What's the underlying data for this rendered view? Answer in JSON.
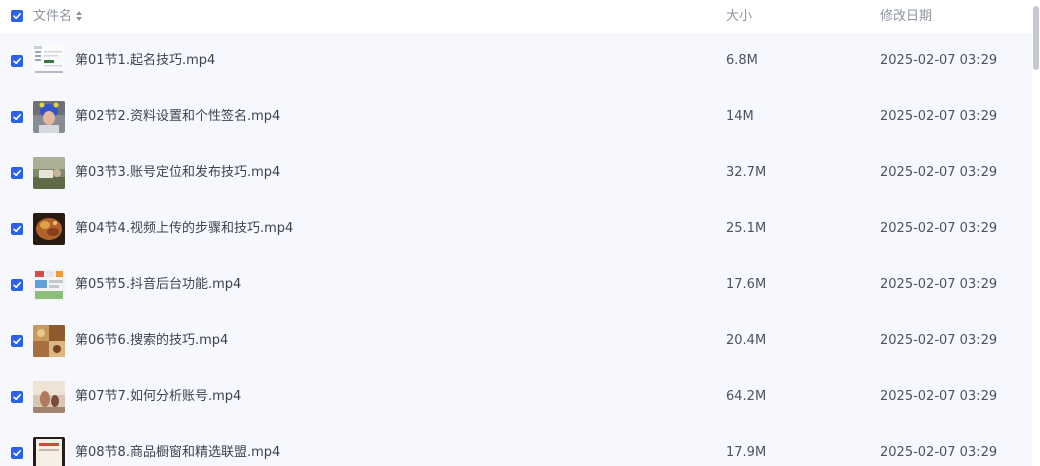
{
  "header": {
    "name_label": "文件名",
    "size_label": "大小",
    "date_label": "修改日期"
  },
  "files": [
    {
      "name": "第01节1.起名技巧.mp4",
      "size": "6.8M",
      "modified": "2025-02-07 03:29",
      "thumbnail": "video-thumbnail-screenshot"
    },
    {
      "name": "第02节2.资料设置和个性签名.mp4",
      "size": "14M",
      "modified": "2025-02-07 03:29",
      "thumbnail": "video-thumbnail-person-blue-cap"
    },
    {
      "name": "第03节3.账号定位和发布技巧.mp4",
      "size": "32.7M",
      "modified": "2025-02-07 03:29",
      "thumbnail": "video-thumbnail-outdoor"
    },
    {
      "name": "第04节4.视频上传的步骤和技巧.mp4",
      "size": "25.1M",
      "modified": "2025-02-07 03:29",
      "thumbnail": "video-thumbnail-food"
    },
    {
      "name": "第05节5.抖音后台功能.mp4",
      "size": "17.6M",
      "modified": "2025-02-07 03:29",
      "thumbnail": "video-thumbnail-app-screen"
    },
    {
      "name": "第06节6.搜索的技巧.mp4",
      "size": "20.4M",
      "modified": "2025-02-07 03:29",
      "thumbnail": "video-thumbnail-food-grid"
    },
    {
      "name": "第07节7.如何分析账号.mp4",
      "size": "64.2M",
      "modified": "2025-02-07 03:29",
      "thumbnail": "video-thumbnail-room"
    },
    {
      "name": "第08节8.商品橱窗和精选联盟.mp4",
      "size": "17.9M",
      "modified": "2025-02-07 03:29",
      "thumbnail": "video-thumbnail-product"
    }
  ],
  "colors": {
    "accent": "#2c62e6",
    "row_background": "#f7f8fd",
    "header_text": "#8f95a0"
  }
}
